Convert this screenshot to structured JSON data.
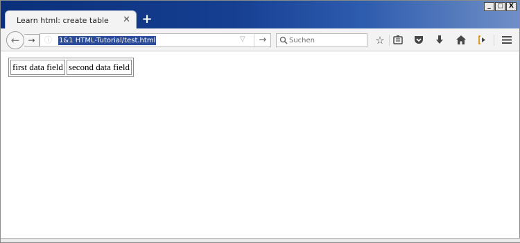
{
  "tab": {
    "title": "Learn html: create table",
    "close_glyph": "✕",
    "new_tab_glyph": "+"
  },
  "window_controls": {
    "minimize": "_",
    "maximize": "□",
    "close": "X"
  },
  "toolbar": {
    "back_glyph": "←",
    "forward_glyph": "→",
    "url": "1&1 HTML-Tutorial/test.html",
    "go_glyph": "→",
    "search_placeholder": "Suchen",
    "icons": [
      "star-icon",
      "reading-list-icon",
      "pocket-icon",
      "download-icon",
      "home-icon",
      "share-icon",
      "menu-icon"
    ]
  },
  "page": {
    "table": {
      "cells": [
        "first data field",
        "second data field"
      ]
    }
  },
  "colors": {
    "titlebar": "#163f92",
    "url_selection": "#2a4a9a"
  }
}
